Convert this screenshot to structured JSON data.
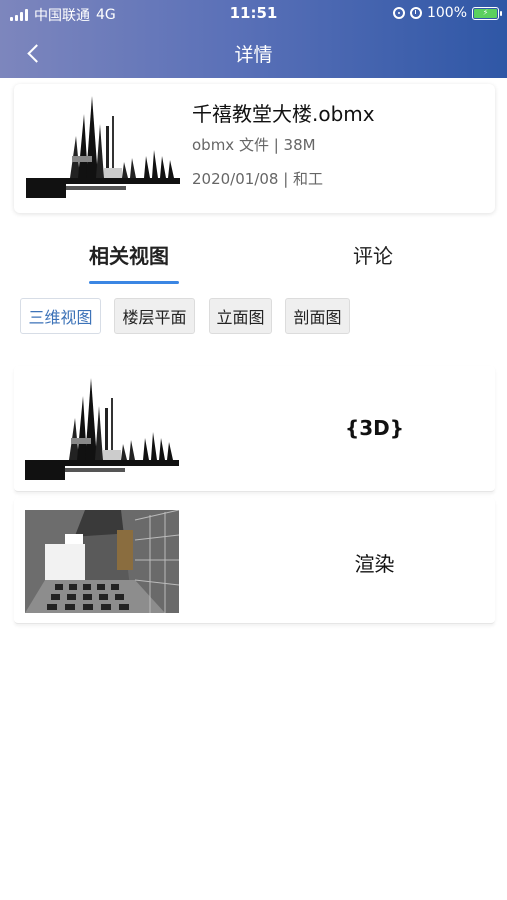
{
  "status_bar": {
    "carrier": "中国联通",
    "network": "4G",
    "time": "11:51",
    "battery": "100%"
  },
  "navbar": {
    "title": "详情",
    "back_icon": "chevron-left-icon"
  },
  "file": {
    "name": "千禧教堂大楼.obmx",
    "meta": "obmx 文件 | 38M",
    "date_author": "2020/01/08 | 和工"
  },
  "tabs": [
    {
      "label": "相关视图",
      "active": true
    },
    {
      "label": "评论",
      "active": false
    }
  ],
  "filters": [
    {
      "label": "三维视图",
      "active": true
    },
    {
      "label": "楼层平面",
      "active": false
    },
    {
      "label": "立面图",
      "active": false
    },
    {
      "label": "剖面图",
      "active": false
    }
  ],
  "views": [
    {
      "label": "{3D}"
    },
    {
      "label": "渲染"
    }
  ],
  "colors": {
    "header_start": "#7d86bd",
    "header_end": "#2f57a6",
    "accent": "#3b86e3",
    "chip_active_text": "#3d73b8"
  }
}
